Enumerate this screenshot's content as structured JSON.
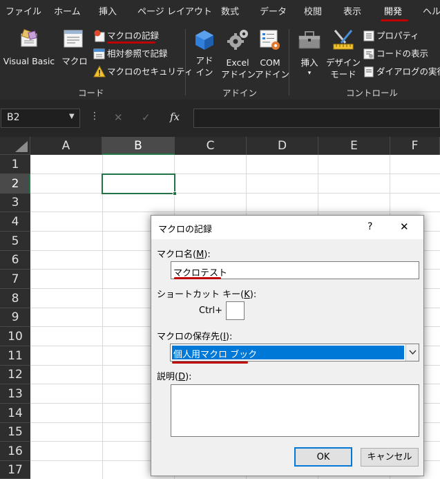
{
  "menu": {
    "items": [
      "ファイル",
      "ホーム",
      "挿入",
      "ページ レイアウト",
      "数式",
      "データ",
      "校閲",
      "表示",
      "開発",
      "ヘルプ"
    ],
    "active": "開発"
  },
  "ribbon": {
    "code_group": {
      "label": "コード",
      "visual_basic": "Visual Basic",
      "macro": "マクロ",
      "record_macro": "マクロの記録",
      "relative_ref": "相対参照で記録",
      "macro_security": "マクロのセキュリティ"
    },
    "addins_group": {
      "label": "アドイン",
      "addin_line1": "アド",
      "addin_line2": "イン",
      "excel_line1": "Excel",
      "excel_line2": "アドイン",
      "com_line1": "COM",
      "com_line2": "アドイン"
    },
    "controls_group": {
      "label": "コントロール",
      "insert": "挿入",
      "design_line1": "デザイン",
      "design_line2": "モード",
      "properties": "プロパティ",
      "view_code": "コードの表示",
      "run_dialog": "ダイアログの実行"
    }
  },
  "formula_bar": {
    "name_box": "B2",
    "fx": "fx",
    "formula": ""
  },
  "sheet": {
    "columns": [
      "A",
      "B",
      "C",
      "D",
      "E",
      "F"
    ],
    "rows": [
      "1",
      "2",
      "3",
      "4",
      "5",
      "6",
      "7",
      "8",
      "9",
      "10",
      "11",
      "12",
      "13",
      "14",
      "15",
      "16",
      "17"
    ],
    "selected_cell": "B2"
  },
  "dialog": {
    "title": "マクロの記録",
    "help": "?",
    "close": "✕",
    "macro_name_label": "マクロ名(",
    "macro_name_key": "M",
    "macro_name_label_end": "):",
    "macro_name_value": "マクロテスト",
    "shortcut_label": "ショートカット キー(",
    "shortcut_key": "K",
    "shortcut_label_end": "):",
    "ctrl_label": "Ctrl+",
    "shortcut_value": "",
    "store_label": "マクロの保存先(",
    "store_key": "I",
    "store_label_end": "):",
    "store_value": "個人用マクロ ブック",
    "desc_label": "説明(",
    "desc_key": "D",
    "desc_label_end": "):",
    "desc_value": "",
    "ok": "OK",
    "cancel": "キャンセル"
  },
  "colors": {
    "annotation_red": "#c00000",
    "selection_green": "#217346",
    "highlight_blue": "#0078d7",
    "addin_blue": "#2f7fdc"
  }
}
